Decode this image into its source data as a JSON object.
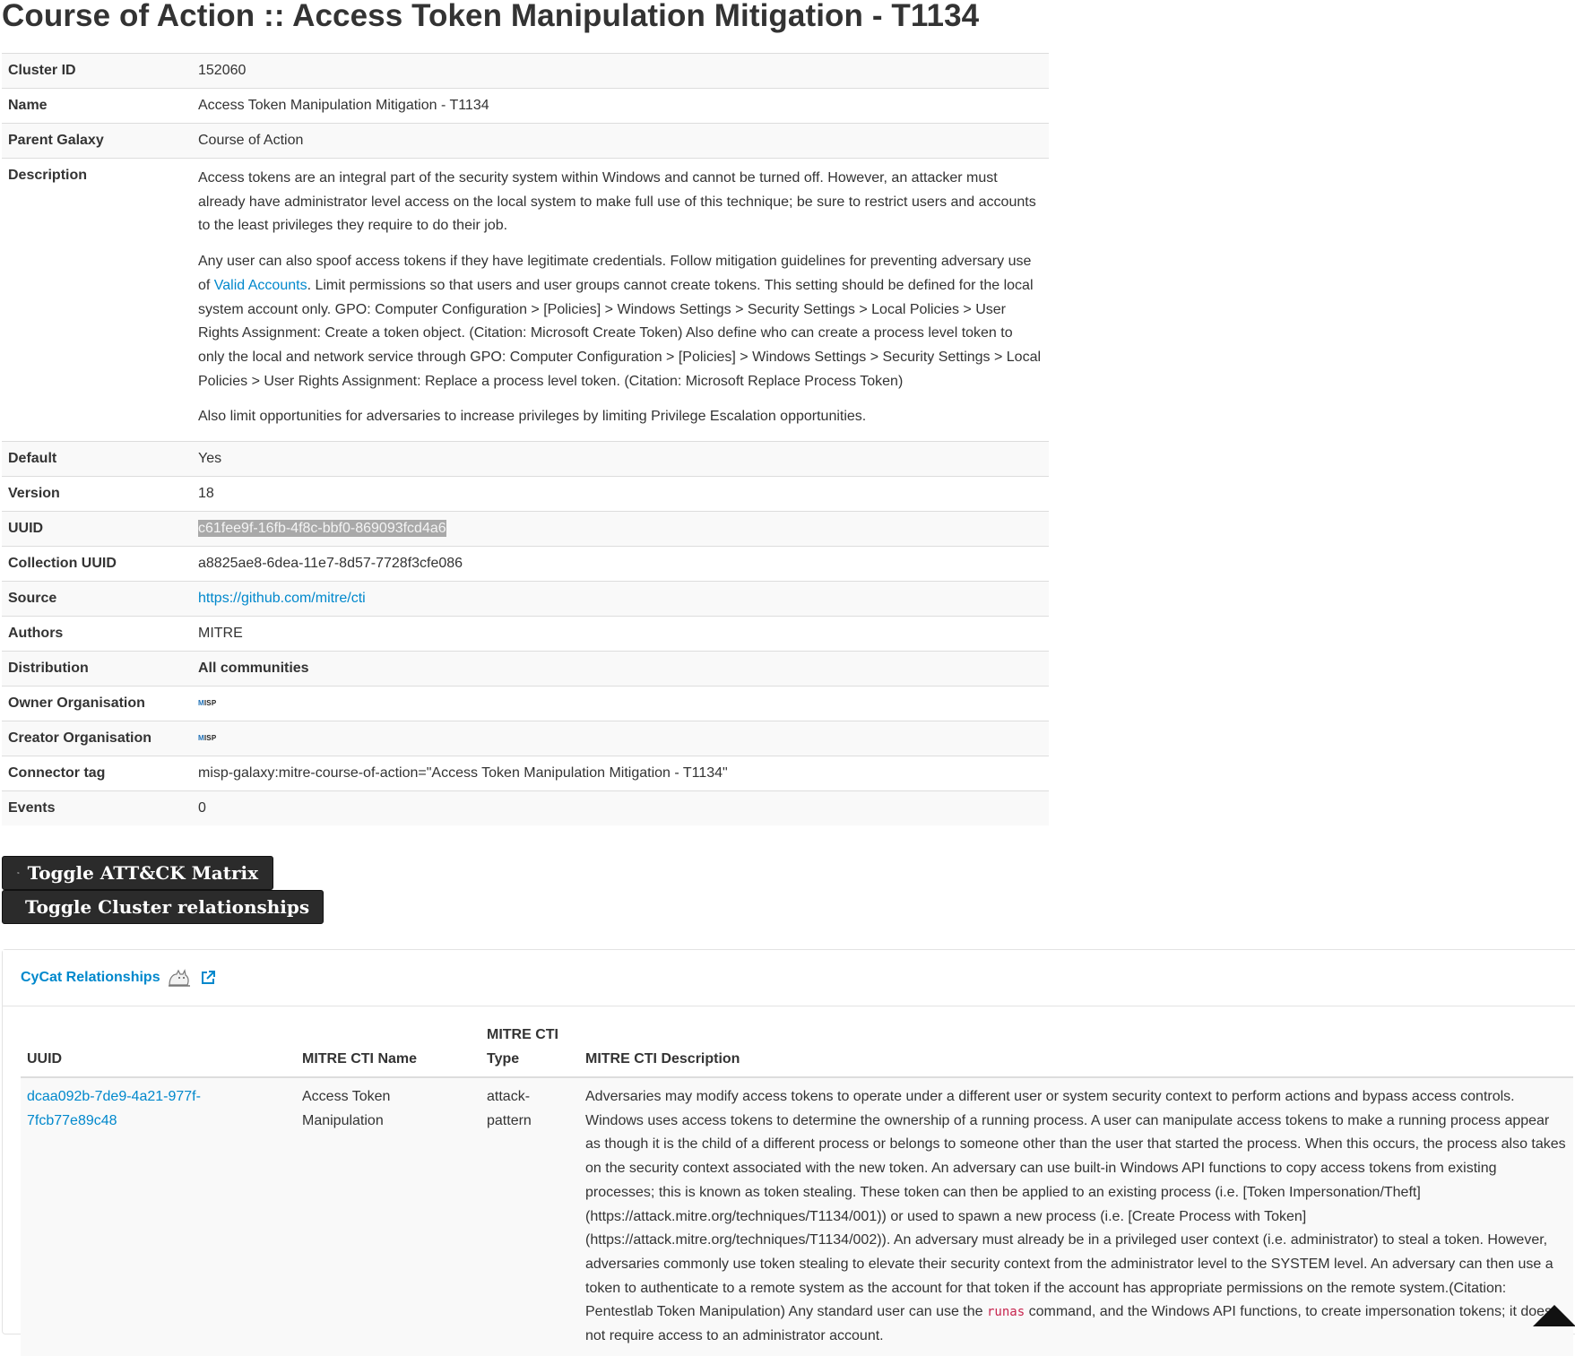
{
  "page": {
    "title": "Course of Action :: Access Token Manipulation Mitigation - T1134"
  },
  "cluster": {
    "cluster_id": {
      "label": "Cluster ID",
      "value": "152060"
    },
    "name": {
      "label": "Name",
      "value": "Access Token Manipulation Mitigation - T1134"
    },
    "parent_galaxy": {
      "label": "Parent Galaxy",
      "value": "Course of Action"
    },
    "description": {
      "label": "Description",
      "p1": "Access tokens are an integral part of the security system within Windows and cannot be turned off. However, an attacker must already have administrator level access on the local system to make full use of this technique; be sure to restrict users and accounts to the least privileges they require to do their job.",
      "p2_pre": "Any user can also spoof access tokens if they have legitimate credentials. Follow mitigation guidelines for preventing adversary use of ",
      "p2_link": "Valid Accounts",
      "p2_post": ". Limit permissions so that users and user groups cannot create tokens. This setting should be defined for the local system account only. GPO: Computer Configuration > [Policies] > Windows Settings > Security Settings > Local Policies > User Rights Assignment: Create a token object. (Citation: Microsoft Create Token) Also define who can create a process level token to only the local and network service through GPO: Computer Configuration > [Policies] > Windows Settings > Security Settings > Local Policies > User Rights Assignment: Replace a process level token. (Citation: Microsoft Replace Process Token)",
      "p3": "Also limit opportunities for adversaries to increase privileges by limiting Privilege Escalation opportunities."
    },
    "default": {
      "label": "Default",
      "value": "Yes"
    },
    "version": {
      "label": "Version",
      "value": "18"
    },
    "uuid": {
      "label": "UUID",
      "value": "c61fee9f-16fb-4f8c-bbf0-869093fcd4a6"
    },
    "collection_uuid": {
      "label": "Collection UUID",
      "value": "a8825ae8-6dea-11e7-8d57-7728f3cfe086"
    },
    "source": {
      "label": "Source",
      "value": "https://github.com/mitre/cti"
    },
    "authors": {
      "label": "Authors",
      "value": "MITRE"
    },
    "distribution": {
      "label": "Distribution",
      "value": "All communities"
    },
    "owner_org": {
      "label": "Owner Organisation",
      "logo_text_m": "M",
      "logo_text_rest": "ISP"
    },
    "creator_org": {
      "label": "Creator Organisation",
      "logo_text_m": "M",
      "logo_text_rest": "ISP"
    },
    "connector_tag": {
      "label": "Connector tag",
      "value": "misp-galaxy:mitre-course-of-action=\"Access Token Manipulation Mitigation - T1134\""
    },
    "events": {
      "label": "Events",
      "value": "0"
    }
  },
  "buttons": {
    "toggle_matrix": "Toggle ATT&CK Matrix",
    "toggle_cluster": "Toggle Cluster relationships",
    "icon": "eye-slash-icon"
  },
  "cycat": {
    "title": "CyCat Relationships",
    "icons": [
      "cycat-logo-icon",
      "external-link-icon"
    ],
    "columns": {
      "uuid": "UUID",
      "name": "MITRE CTI Name",
      "type_line1": "MITRE CTI",
      "type_line2": "Type",
      "description": "MITRE CTI Description"
    },
    "rows": [
      {
        "uuid": "dcaa092b-7de9-4a21-977f-7fcb77e89c48",
        "name": "Access Token Manipulation",
        "type": "attack-pattern",
        "description_pre": "Adversaries may modify access tokens to operate under a different user or system security context to perform actions and bypass access controls. Windows uses access tokens to determine the ownership of a running process. A user can manipulate access tokens to make a running process appear as though it is the child of a different process or belongs to someone other than the user that started the process. When this occurs, the process also takes on the security context associated with the new token. An adversary can use built-in Windows API functions to copy access tokens from existing processes; this is known as token stealing. These token can then be applied to an existing process (i.e. [Token Impersonation/Theft](https://attack.mitre.org/techniques/T1134/001)) or used to spawn a new process (i.e. [Create Process with Token](https://attack.mitre.org/techniques/T1134/002)). An adversary must already be in a privileged user context (i.e. administrator) to steal a token. However, adversaries commonly use token stealing to elevate their security context from the administrator level to the SYSTEM level. An adversary can then use a token to authenticate to a remote system as the account for that token if the account has appropriate permissions on the remote system.(Citation: Pentestlab Token Manipulation) Any standard user can use the ",
        "description_code": "runas",
        "description_post": " command, and the Windows API functions, to create impersonation tokens; it does not require access to an administrator account."
      }
    ]
  },
  "colors": {
    "link": "#0088cc",
    "button_bg": "#2b2b2b",
    "stripe": "#f9f9f9",
    "code": "#c7254e",
    "uuid_highlight": "#a9a9a9"
  }
}
